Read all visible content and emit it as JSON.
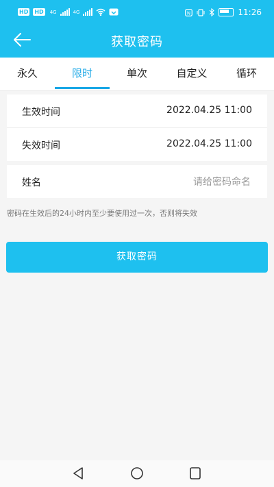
{
  "status_bar": {
    "left_chips": [
      "HD",
      "HD"
    ],
    "network_left": "4G",
    "network_right": "4G",
    "time": "11:26",
    "icons": [
      "nfc-icon",
      "vibrate-icon",
      "bluetooth-icon",
      "battery-icon"
    ]
  },
  "header": {
    "title": "获取密码",
    "back_icon": "arrow-left-icon",
    "background": "#1ec0ef"
  },
  "tabs": [
    {
      "label": "永久",
      "active": false
    },
    {
      "label": "限时",
      "active": true
    },
    {
      "label": "单次",
      "active": false
    },
    {
      "label": "自定义",
      "active": false
    },
    {
      "label": "循环",
      "active": false
    }
  ],
  "form": {
    "start": {
      "label": "生效时间",
      "value": "2022.04.25 11:00"
    },
    "end": {
      "label": "失效时间",
      "value": "2022.04.25 11:00"
    },
    "name": {
      "label": "姓名",
      "placeholder": "请给密码命名",
      "value": ""
    }
  },
  "hint": "密码在生效后的24小时内至少要使用过一次，否则将失效",
  "submit_button": "获取密码",
  "colors": {
    "accent": "#1ec0ef",
    "tab_active": "#1aa7e6"
  },
  "nav_icons": [
    "back-triangle-icon",
    "home-circle-icon",
    "recents-square-icon"
  ]
}
